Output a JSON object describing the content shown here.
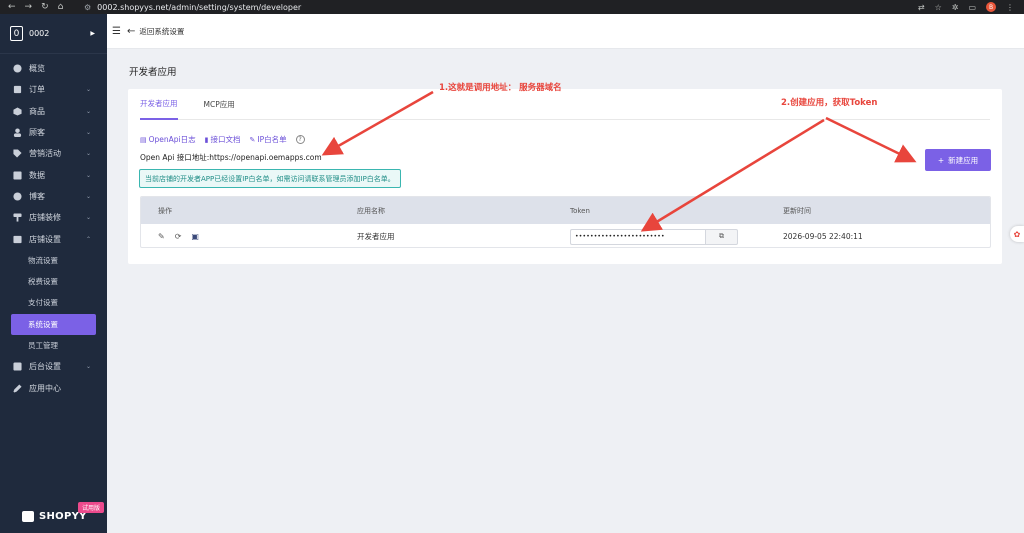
{
  "browser": {
    "url": "0002.shopyys.net/admin/setting/system/developer",
    "avatar_letter": "B"
  },
  "sidebar": {
    "store_logo": "0",
    "store_name": "0002",
    "items": [
      {
        "label": "概览",
        "icon": "gauge-icon"
      },
      {
        "label": "订单",
        "icon": "order-icon",
        "expandable": true
      },
      {
        "label": "商品",
        "icon": "cube-icon",
        "expandable": true
      },
      {
        "label": "顾客",
        "icon": "user-icon",
        "expandable": true
      },
      {
        "label": "营销活动",
        "icon": "tag-icon",
        "expandable": true
      },
      {
        "label": "数据",
        "icon": "chart-icon",
        "expandable": true
      },
      {
        "label": "博客",
        "icon": "blog-icon",
        "expandable": true
      },
      {
        "label": "店铺装修",
        "icon": "brush-icon",
        "expandable": true
      },
      {
        "label": "店铺设置",
        "icon": "store-settings-icon",
        "expanded": true
      }
    ],
    "subitems": [
      {
        "label": "物流设置"
      },
      {
        "label": "税费设置"
      },
      {
        "label": "支付设置"
      },
      {
        "label": "系统设置",
        "active": true
      },
      {
        "label": "员工管理"
      }
    ],
    "bottom_items": [
      {
        "label": "后台设置",
        "icon": "settings-icon",
        "expandable": true
      },
      {
        "label": "应用中心",
        "icon": "wrench-icon"
      }
    ],
    "brand": "SHOPYY",
    "trial_badge": "试用版"
  },
  "topbar": {
    "back_label": "返回系统设置"
  },
  "page": {
    "title": "开发者应用",
    "tabs": [
      {
        "label": "开发者应用",
        "active": true
      },
      {
        "label": "MCP应用"
      }
    ],
    "links": {
      "log": "OpenApi日志",
      "docs": "接口文档",
      "ip": "IP白名单"
    },
    "api_address": "Open Api 接口地址:https://openapi.oemapps.com",
    "notice": "当前店铺的开发者APP已经设置IP白名单，如需访问请联系管理员添加IP白名单。",
    "new_button": "新建应用",
    "table": {
      "headers": [
        "操作",
        "应用名称",
        "Token",
        "更新时间"
      ],
      "rows": [
        {
          "name": "开发者应用",
          "token": "••••••••••••••••••••••••",
          "updated": "2026-09-05 22:40:11"
        }
      ]
    }
  },
  "annotations": {
    "a1": "1.这就是调用地址：  服务器域名",
    "a2": "2.创建应用，获取Token",
    "color": "#e8453c"
  },
  "colors": {
    "accent": "#7b61e6",
    "sidebar_bg": "#1f2a3d",
    "notice_border": "#3ab6b0"
  }
}
